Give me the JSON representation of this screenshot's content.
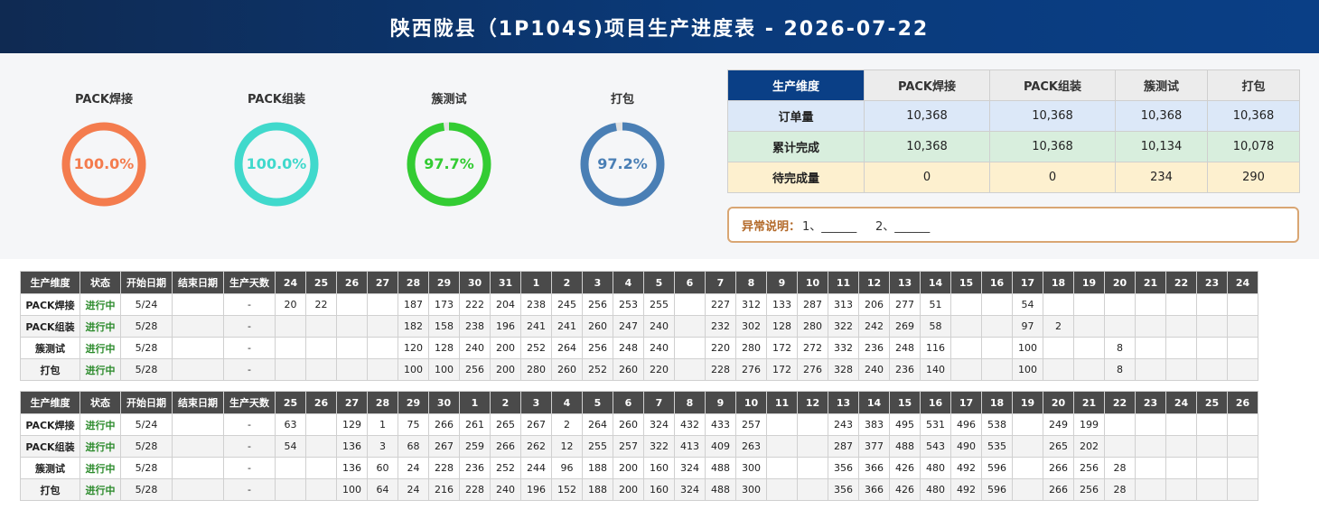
{
  "title": "陕西陇县（1P104S)项目生产进度表 - 2026-07-22",
  "donuts": [
    {
      "label": "PACK焊接",
      "value": "100.0%",
      "pct": 100.0,
      "color": "#f47c4e"
    },
    {
      "label": "PACK组装",
      "value": "100.0%",
      "pct": 100.0,
      "color": "#40d9cc"
    },
    {
      "label": "簇测试",
      "value": "97.7%",
      "pct": 97.7,
      "color": "#33cc33"
    },
    {
      "label": "打包",
      "value": "97.2%",
      "pct": 97.2,
      "color": "#4a7fb5"
    }
  ],
  "summary": {
    "headers": [
      "生产维度",
      "PACK焊接",
      "PACK组装",
      "簇测试",
      "打包"
    ],
    "rows": [
      {
        "label": "订单量",
        "values": [
          "10,368",
          "10,368",
          "10,368",
          "10,368"
        ]
      },
      {
        "label": "累计完成",
        "values": [
          "10,368",
          "10,368",
          "10,134",
          "10,078"
        ]
      },
      {
        "label": "待完成量",
        "values": [
          "0",
          "0",
          "234",
          "290"
        ]
      }
    ]
  },
  "note": {
    "label": "异常说明：",
    "text": "1、______     2、______"
  },
  "grid1": {
    "headers": [
      "生产维度",
      "状态",
      "开始日期",
      "结束日期",
      "生产天数",
      "24",
      "25",
      "26",
      "27",
      "28",
      "29",
      "30",
      "31",
      "1",
      "2",
      "3",
      "4",
      "5",
      "6",
      "7",
      "8",
      "9",
      "10",
      "11",
      "12",
      "13",
      "14",
      "15",
      "16",
      "17",
      "18",
      "19",
      "20",
      "21",
      "22",
      "23",
      "24"
    ],
    "rows": [
      [
        "PACK焊接",
        "进行中",
        "5/24",
        "",
        "-",
        "20",
        "22",
        "",
        "",
        "187",
        "173",
        "222",
        "204",
        "238",
        "245",
        "256",
        "253",
        "255",
        "",
        "227",
        "312",
        "133",
        "287",
        "313",
        "206",
        "277",
        "51",
        "",
        "",
        "54",
        "",
        "",
        "",
        "",
        "",
        "",
        ""
      ],
      [
        "PACK组装",
        "进行中",
        "5/28",
        "",
        "-",
        "",
        "",
        "",
        "",
        "182",
        "158",
        "238",
        "196",
        "241",
        "241",
        "260",
        "247",
        "240",
        "",
        "232",
        "302",
        "128",
        "280",
        "322",
        "242",
        "269",
        "58",
        "",
        "",
        "97",
        "2",
        "",
        "",
        "",
        "",
        "",
        ""
      ],
      [
        "簇测试",
        "进行中",
        "5/28",
        "",
        "-",
        "",
        "",
        "",
        "",
        "120",
        "128",
        "240",
        "200",
        "252",
        "264",
        "256",
        "248",
        "240",
        "",
        "220",
        "280",
        "172",
        "272",
        "332",
        "236",
        "248",
        "116",
        "",
        "",
        "100",
        "",
        "",
        "8",
        "",
        "",
        "",
        ""
      ],
      [
        "打包",
        "进行中",
        "5/28",
        "",
        "-",
        "",
        "",
        "",
        "",
        "100",
        "100",
        "256",
        "200",
        "280",
        "260",
        "252",
        "260",
        "220",
        "",
        "228",
        "276",
        "172",
        "276",
        "328",
        "240",
        "236",
        "140",
        "",
        "",
        "100",
        "",
        "",
        "8",
        "",
        "",
        "",
        ""
      ]
    ]
  },
  "grid2": {
    "headers": [
      "生产维度",
      "状态",
      "开始日期",
      "结束日期",
      "生产天数",
      "25",
      "26",
      "27",
      "28",
      "29",
      "30",
      "1",
      "2",
      "3",
      "4",
      "5",
      "6",
      "7",
      "8",
      "9",
      "10",
      "11",
      "12",
      "13",
      "14",
      "15",
      "16",
      "17",
      "18",
      "19",
      "20",
      "21",
      "22",
      "23",
      "24",
      "25",
      "26"
    ],
    "rows": [
      [
        "PACK焊接",
        "进行中",
        "5/24",
        "",
        "-",
        "63",
        "",
        "129",
        "1",
        "75",
        "266",
        "261",
        "265",
        "267",
        "2",
        "264",
        "260",
        "324",
        "432",
        "433",
        "257",
        "",
        "",
        "243",
        "383",
        "495",
        "531",
        "496",
        "538",
        "",
        "249",
        "199",
        "",
        "",
        "",
        "",
        ""
      ],
      [
        "PACK组装",
        "进行中",
        "5/28",
        "",
        "-",
        "54",
        "",
        "136",
        "3",
        "68",
        "267",
        "259",
        "266",
        "262",
        "12",
        "255",
        "257",
        "322",
        "413",
        "409",
        "263",
        "",
        "",
        "287",
        "377",
        "488",
        "543",
        "490",
        "535",
        "",
        "265",
        "202",
        "",
        "",
        "",
        "",
        ""
      ],
      [
        "簇测试",
        "进行中",
        "5/28",
        "",
        "-",
        "",
        "",
        "136",
        "60",
        "24",
        "228",
        "236",
        "252",
        "244",
        "96",
        "188",
        "200",
        "160",
        "324",
        "488",
        "300",
        "",
        "",
        "356",
        "366",
        "426",
        "480",
        "492",
        "596",
        "",
        "266",
        "256",
        "28",
        "",
        "",
        "",
        ""
      ],
      [
        "打包",
        "进行中",
        "5/28",
        "",
        "-",
        "",
        "",
        "100",
        "64",
        "24",
        "216",
        "228",
        "240",
        "196",
        "152",
        "188",
        "200",
        "160",
        "324",
        "488",
        "300",
        "",
        "",
        "356",
        "366",
        "426",
        "480",
        "492",
        "596",
        "",
        "266",
        "256",
        "28",
        "",
        "",
        "",
        ""
      ]
    ]
  }
}
